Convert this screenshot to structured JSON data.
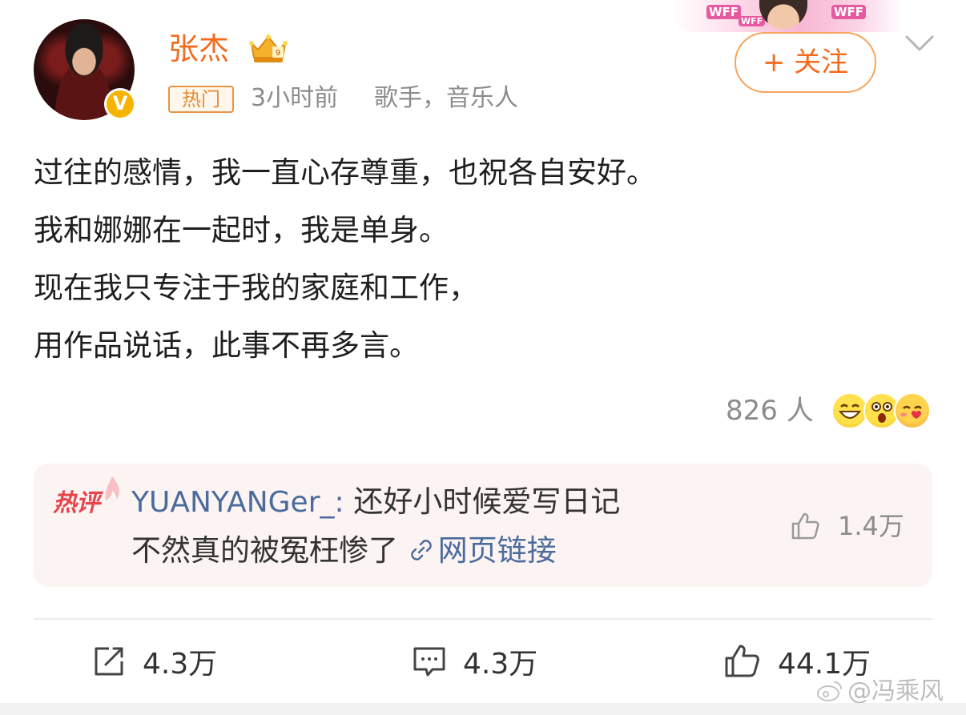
{
  "post": {
    "author": {
      "name": "张杰",
      "verified_mark": "V",
      "avatar_icon": "avatar-photo",
      "vip_icon": "crown-vip-icon"
    },
    "banner": {
      "wff_1": "WFF",
      "wff_2": "WFF",
      "wff_3": "WFF"
    },
    "meta": {
      "tag": "热门",
      "time": "3小时前",
      "description": "歌手，音乐人"
    },
    "follow_button": "+ 关注",
    "content_lines": [
      "过往的感情，我一直心存尊重，也祝各自安好。",
      "我和娜娜在一起时，我是单身。",
      "现在我只专注于我的家庭和工作，",
      "用作品说话，此事不再多言。"
    ],
    "reactions": {
      "count_text": "826 人",
      "emojis": [
        "laugh-emoji",
        "surprise-emoji",
        "love-emoji"
      ]
    },
    "hot_comment": {
      "badge": "热评",
      "author": "YUANYANGer_",
      "separator": ":",
      "text_line1": " 还好小时候爱写日记",
      "text_line2": "不然真的被冤枉惨了 ",
      "link_text": "网页链接",
      "likes": "1.4万"
    },
    "actions": {
      "repost": "4.3万",
      "comment": "4.3万",
      "like": "44.1万"
    },
    "watermark": "@冯乘风"
  },
  "colors": {
    "accent": "#f36b1c",
    "link": "#4b6b9c",
    "muted": "#8c8c8c",
    "hot_badge": "#e8444b",
    "hot_comment_bg": "#fbf4f3"
  }
}
